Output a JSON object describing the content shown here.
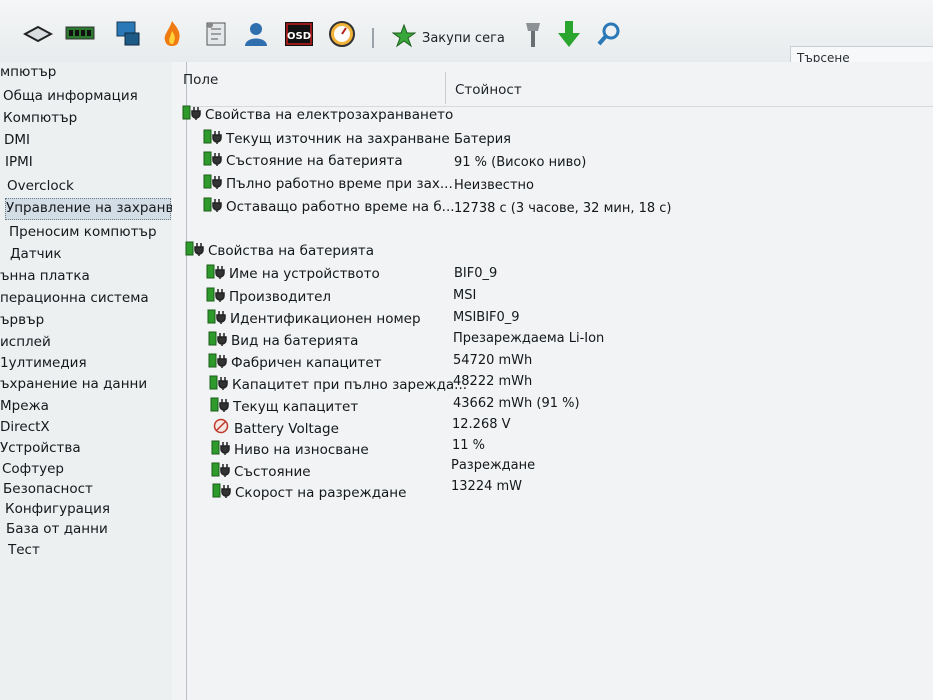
{
  "toolbar": {
    "buy_license_label": "Закупи сега",
    "search_value": "Търсене",
    "icons": [
      "chip-icon",
      "ram-icon",
      "computer-icon",
      "fire-icon",
      "report-icon",
      "user-icon",
      "osd-icon",
      "gauge-icon",
      "star-icon",
      "wrench-icon",
      "download-arrow-icon",
      "search-icon"
    ],
    "osd_text": "OSD"
  },
  "tree": {
    "items": [
      {
        "label": "мпютър"
      },
      {
        "label": "Обща информация"
      },
      {
        "label": "Компютър"
      },
      {
        "label": "DMI"
      },
      {
        "label": "IPMI"
      },
      {
        "label": "Overclock"
      },
      {
        "label": "Управление на захранва"
      },
      {
        "label": "Преносим компютър"
      },
      {
        "label": "Датчик"
      },
      {
        "label": "ънна платка"
      },
      {
        "label": "перационна система"
      },
      {
        "label": "ървър"
      },
      {
        "label": "исплей"
      },
      {
        "label": "1ултимедия"
      },
      {
        "label": "ъхранение на данни"
      },
      {
        "label": "Мрежа"
      },
      {
        "label": "DirectX"
      },
      {
        "label": "Устройства"
      },
      {
        "label": "Софтуер"
      },
      {
        "label": "Безопасност"
      },
      {
        "label": "Конфигурация"
      },
      {
        "label": "База от данни"
      },
      {
        "label": "Тест"
      }
    ]
  },
  "table": {
    "col_field": "Поле",
    "col_value": "Стойност",
    "groups": [
      {
        "title": "Свойства на електрозахранването",
        "rows": [
          {
            "field": "Текущ източник на захранване",
            "value": "Батерия",
            "icon": "battery-plug-icon"
          },
          {
            "field": "Състояние на батерията",
            "value": "91 % (Високо ниво)",
            "icon": "battery-plug-icon"
          },
          {
            "field": "Пълно работно време при зах...",
            "value": "Неизвестно",
            "icon": "battery-plug-icon"
          },
          {
            "field": "Оставащо работно време на б...",
            "value": "12738 с (3 часове, 32 мин, 18 с)",
            "icon": "battery-plug-icon"
          }
        ]
      },
      {
        "title": "Свойства на батерията",
        "rows": [
          {
            "field": "Име на устройството",
            "value": "BIF0_9",
            "icon": "battery-plug-icon"
          },
          {
            "field": "Производител",
            "value": "MSI",
            "icon": "battery-plug-icon"
          },
          {
            "field": "Идентификационен номер",
            "value": "MSIBIF0_9",
            "icon": "battery-plug-icon"
          },
          {
            "field": "Вид на батерията",
            "value": "Презареждаема Li-Ion",
            "icon": "battery-plug-icon"
          },
          {
            "field": "Фабричен капацитет",
            "value": "54720 mWh",
            "icon": "battery-plug-icon"
          },
          {
            "field": "Капацитет при пълно зарежда...",
            "value": "48222 mWh",
            "icon": "battery-plug-icon"
          },
          {
            "field": "Текущ капацитет",
            "value": "43662 mWh  (91 %)",
            "icon": "battery-plug-icon"
          },
          {
            "field": "Battery Voltage",
            "value": "12.268 V",
            "icon": "voltage-icon"
          },
          {
            "field": "Ниво на износване",
            "value": "11 %",
            "icon": "battery-plug-icon"
          },
          {
            "field": "Състояние",
            "value": "Разреждане",
            "icon": "battery-plug-icon"
          },
          {
            "field": "Скорост на разреждане",
            "value": "13224 mW",
            "icon": "battery-plug-icon"
          }
        ]
      }
    ]
  },
  "colors": {
    "battery_green": "#2e9a2b",
    "accent_blue": "#2a78b8"
  }
}
